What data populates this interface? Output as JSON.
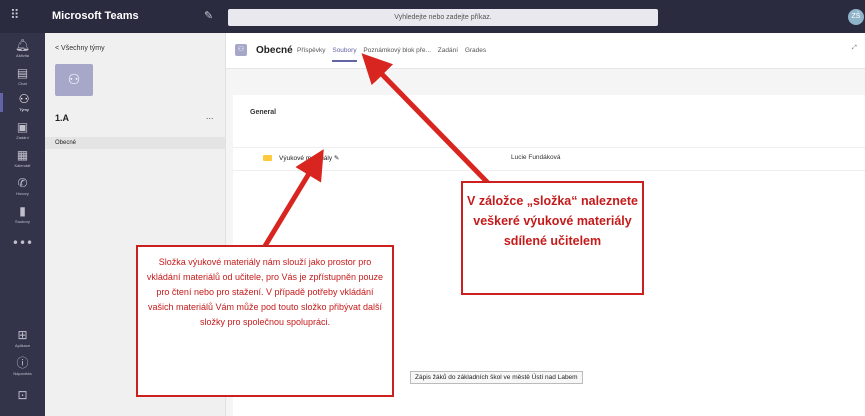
{
  "topbar": {
    "app_name": "Microsoft Teams",
    "search_placeholder": "Vyhledejte nebo zadejte příkaz.",
    "avatar_initials": "ZŠ"
  },
  "rail": {
    "items": [
      {
        "label": "Aktivita",
        "icon": "bell-icon"
      },
      {
        "label": "Chat",
        "icon": "chat-icon"
      },
      {
        "label": "Týmy",
        "icon": "teams-icon",
        "active": true
      },
      {
        "label": "Zadání",
        "icon": "assignments-icon"
      },
      {
        "label": "Kalendář",
        "icon": "calendar-icon"
      },
      {
        "label": "Hovory",
        "icon": "phone-icon"
      },
      {
        "label": "Soubory",
        "icon": "files-icon"
      },
      {
        "label": "",
        "icon": "more-icon"
      }
    ],
    "bottom": [
      {
        "label": "Aplikace",
        "icon": "apps-icon"
      },
      {
        "label": "Nápověda",
        "icon": "help-icon"
      },
      {
        "label": "",
        "icon": "download-icon"
      }
    ]
  },
  "left": {
    "back_label": "Všechny týmy",
    "team_name": "1.A",
    "more": "...",
    "channel": "Obecné"
  },
  "main": {
    "channel_name": "Obecné",
    "tabs": [
      "Příspěvky",
      "Soubory",
      "Poznámkový blok pře...",
      "Zadání",
      "Grades"
    ],
    "active_tab": "Soubory",
    "section": "General",
    "file": {
      "name": "Výukové materiály",
      "owner": "Lucie Fundáková"
    },
    "tooltip": "Zápis žáků do základních škol ve městě Ústí nad Labem"
  },
  "annotations": {
    "note1": "V záložce „složka“ naleznete veškeré výukové materiály sdílené učitelem",
    "note2": "Složka výukové materiály nám slouží jako prostor pro vkládání materiálů od učitele, pro Vás je zpřístupněn pouze pro čtení nebo pro stažení. V případě potřeby vkládání vašich materiálů Vám může pod touto složko přibývat další složky pro společnou spolupráci."
  },
  "colors": {
    "accent": "#6264a7",
    "annotation_red": "#cc2020"
  }
}
